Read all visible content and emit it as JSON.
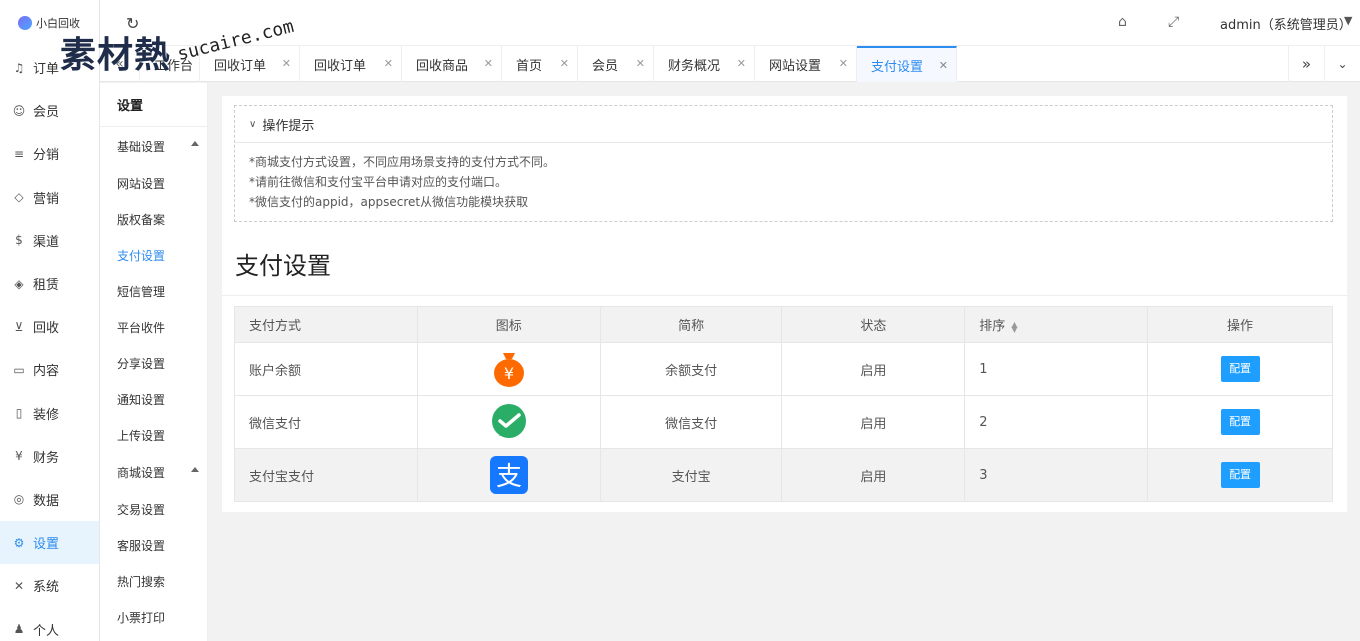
{
  "brand": {
    "logo_text": "小白回收",
    "watermark": "素材熱",
    "watermark_sub": "sucaire.com"
  },
  "header": {
    "admin_label": "admin（系统管理员）",
    "icons": [
      "refresh-icon",
      "tag-icon",
      "fullscreen-icon",
      "chevron-down-icon"
    ]
  },
  "main_nav": [
    {
      "label": "订单",
      "icon": "bell-icon"
    },
    {
      "label": "会员",
      "icon": "user-icon"
    },
    {
      "label": "分销",
      "icon": "layers-icon"
    },
    {
      "label": "营销",
      "icon": "diamond-icon"
    },
    {
      "label": "渠道",
      "icon": "dollar-icon"
    },
    {
      "label": "租赁",
      "icon": "shield-icon"
    },
    {
      "label": "回收",
      "icon": "cart-icon"
    },
    {
      "label": "内容",
      "icon": "book-icon"
    },
    {
      "label": "装修",
      "icon": "tablet-icon"
    },
    {
      "label": "财务",
      "icon": "yen-icon"
    },
    {
      "label": "数据",
      "icon": "globe-icon"
    },
    {
      "label": "设置",
      "icon": "gear-icon",
      "active": true
    },
    {
      "label": "系统",
      "icon": "tools-icon"
    },
    {
      "label": "个人",
      "icon": "person-icon"
    }
  ],
  "tabs": [
    {
      "label": "工作台"
    },
    {
      "label": "回收订单"
    },
    {
      "label": "回收订单"
    },
    {
      "label": "回收商品"
    },
    {
      "label": "首页"
    },
    {
      "label": "会员"
    },
    {
      "label": "财务概况"
    },
    {
      "label": "网站设置"
    },
    {
      "label": "支付设置",
      "active": true
    }
  ],
  "sub_nav": {
    "title": "设置",
    "groups": [
      {
        "label": "基础设置",
        "items": [
          "网站设置",
          "版权备案",
          "支付设置",
          "短信管理",
          "平台收件",
          "分享设置",
          "通知设置",
          "上传设置"
        ]
      },
      {
        "label": "商城设置",
        "items": [
          "交易设置",
          "客服设置",
          "热门搜索",
          "小票打印"
        ]
      }
    ],
    "active_item": "支付设置"
  },
  "tips": {
    "title": "操作提示",
    "lines": [
      "*商城支付方式设置，不同应用场景支持的支付方式不同。",
      "*请前往微信和支付宝平台申请对应的支付端口。",
      "*微信支付的appid，appsecret从微信功能模块获取"
    ]
  },
  "page": {
    "heading": "支付设置"
  },
  "table": {
    "headers": [
      "支付方式",
      "图标",
      "简称",
      "状态",
      "排序",
      "操作"
    ],
    "rows": [
      {
        "method": "账户余额",
        "icon": "balance-bag-icon",
        "short": "余额支付",
        "status": "启用",
        "order": "1",
        "action": "配置"
      },
      {
        "method": "微信支付",
        "icon": "wechat-pay-icon",
        "short": "微信支付",
        "status": "启用",
        "order": "2",
        "action": "配置"
      },
      {
        "method": "支付宝支付",
        "icon": "alipay-icon",
        "short": "支付宝",
        "status": "启用",
        "order": "3",
        "action": "配置"
      }
    ]
  },
  "colors": {
    "accent": "#2d8cf0",
    "button": "#1e9fff",
    "balance": "#ff6a00",
    "wechat": "#2aae67",
    "alipay": "#1677ff"
  }
}
